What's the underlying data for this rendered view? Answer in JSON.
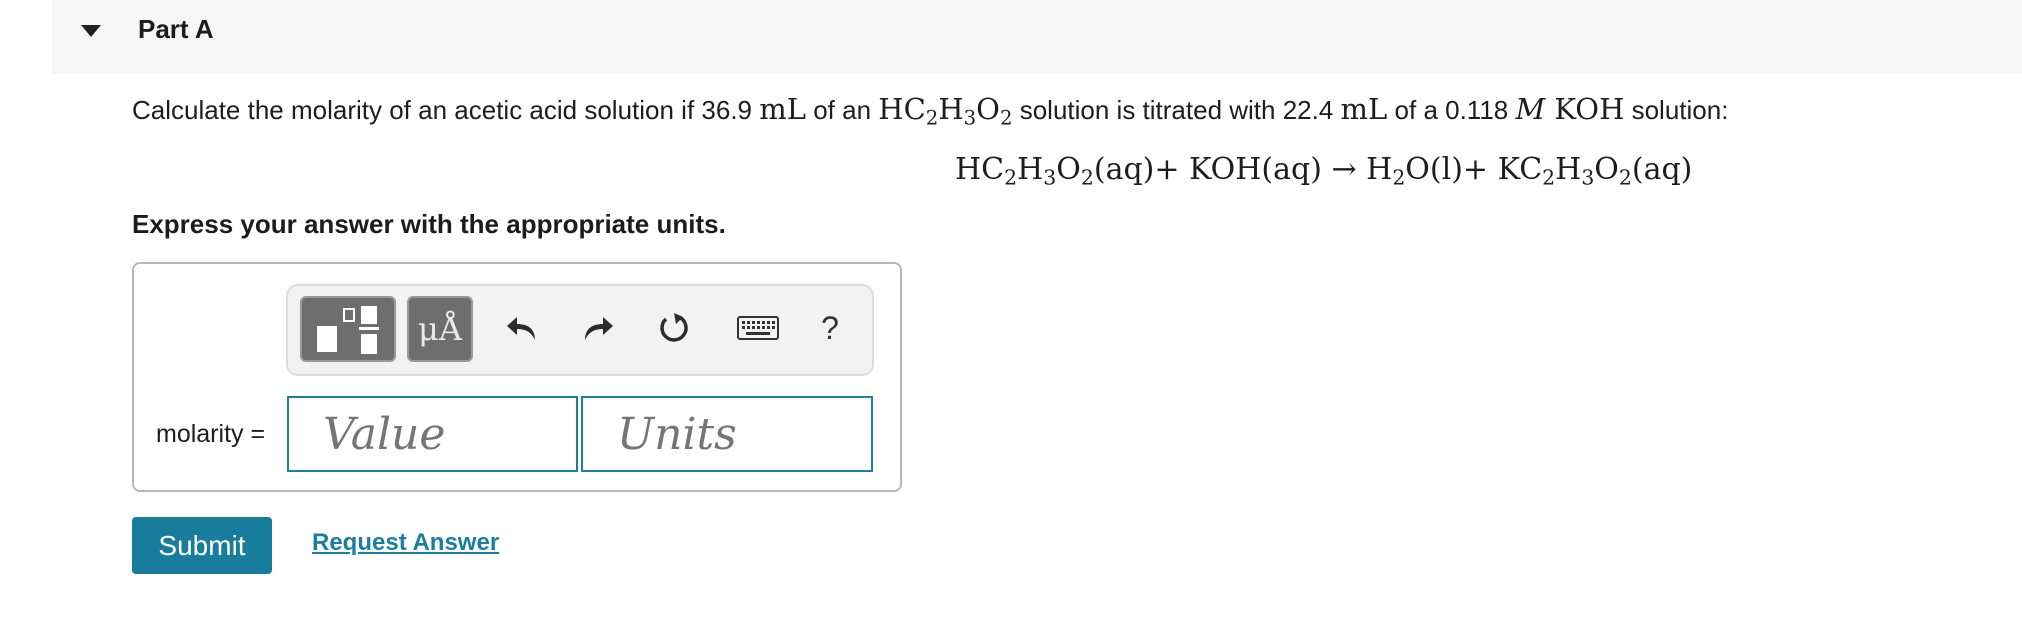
{
  "part": {
    "title": "Part A"
  },
  "question": {
    "text_1": "Calculate the molarity of an acetic acid solution if 36.9 ",
    "unit_ml_1": "mL",
    "text_2": " of an ",
    "formula_parts": [
      "HC",
      "2",
      "H",
      "3",
      "O",
      "2"
    ],
    "text_3": " solution is titrated with 22.4 ",
    "unit_ml_2": "mL",
    "text_4": " of a 0.118 ",
    "molar_symbol": "M",
    "koh": " KOH",
    "text_5": " solution:"
  },
  "equation": {
    "r1": [
      "HC",
      "2",
      "H",
      "3",
      "O",
      "2",
      "(aq)"
    ],
    "plus_1": "+ ",
    "r2": "KOH(aq)",
    "arrow": " → ",
    "p1": [
      "H",
      "2",
      "O(l)"
    ],
    "plus_2": "+ ",
    "p2": [
      "KC",
      "2",
      "H",
      "3",
      "O",
      "2",
      "(aq)"
    ]
  },
  "instruction": "Express your answer with the appropriate units.",
  "toolbar": {
    "template_icon": "fraction-template-icon",
    "units_label": "μÅ",
    "undo_icon": "undo-icon",
    "redo_icon": "redo-icon",
    "reset_icon": "reset-icon",
    "keyboard_icon": "keyboard-icon",
    "help_label": "?"
  },
  "answer": {
    "label": "molarity =",
    "value_placeholder": "Value",
    "units_placeholder": "Units"
  },
  "actions": {
    "submit_label": "Submit",
    "request_label": "Request Answer"
  },
  "colors": {
    "accent": "#187c9d",
    "link": "#1a7ea3",
    "input_border": "#1b7fa0"
  }
}
